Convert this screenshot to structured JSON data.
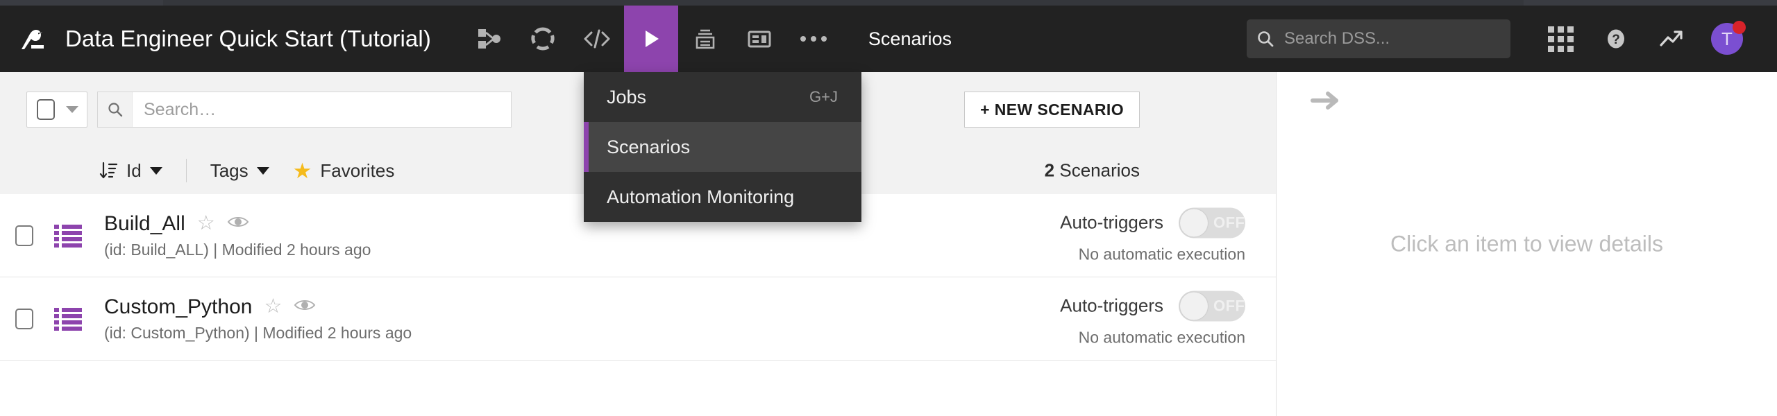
{
  "header": {
    "logo_icon": "dataiku-bird-logo",
    "project_title": "Data Engineer Quick Start (Tutorial)",
    "breadcrumb": "Scenarios",
    "nav_icons": [
      {
        "name": "flow-icon",
        "label": "Flow"
      },
      {
        "name": "lab-icon",
        "label": "Lab"
      },
      {
        "name": "code-icon",
        "label": "Code"
      },
      {
        "name": "automation-play-icon",
        "label": "Automation",
        "active": true
      },
      {
        "name": "print-stack-icon",
        "label": "Deployer"
      },
      {
        "name": "dashboard-icon",
        "label": "Dashboards"
      },
      {
        "name": "more-dots-icon",
        "label": "More"
      }
    ],
    "search": {
      "placeholder": "Search DSS...",
      "icon": "search-icon"
    },
    "right_icons": [
      {
        "name": "apps-grid-icon"
      },
      {
        "name": "help-question-icon"
      },
      {
        "name": "trends-arrow-icon"
      }
    ],
    "avatar": {
      "initials": "T",
      "has_notification": true,
      "color": "#7b4fd1"
    }
  },
  "dropdown": {
    "items": [
      {
        "label": "Jobs",
        "shortcut": "G+J",
        "highlighted": false
      },
      {
        "label": "Scenarios",
        "shortcut": "",
        "highlighted": true
      },
      {
        "label": "Automation Monitoring",
        "shortcut": "",
        "highlighted": false
      }
    ]
  },
  "toolbar": {
    "select_all_checkbox": "",
    "search_placeholder": "Search…",
    "new_scenario_label": "+ NEW SCENARIO"
  },
  "filterbar": {
    "sort_icon": "sort-descending-icon",
    "sort_label": "Id",
    "tags_label": "Tags",
    "favorites_label": "Favorites",
    "favorites_icon": "star-filled-icon",
    "count_number": "2",
    "count_label": "Scenarios"
  },
  "rows": [
    {
      "name": "Build_All",
      "meta": "(id: Build_ALL) | Modified 2 hours ago",
      "icon": "scenario-list-icon",
      "star": "star-outline-icon",
      "watch": "eye-icon",
      "trigger_label": "Auto-triggers",
      "toggle_state": "OFF",
      "execution_note": "No automatic execution"
    },
    {
      "name": "Custom_Python",
      "meta": "(id: Custom_Python) | Modified 2 hours ago",
      "icon": "scenario-list-icon",
      "star": "star-outline-icon",
      "watch": "eye-icon",
      "trigger_label": "Auto-triggers",
      "toggle_state": "OFF",
      "execution_note": "No automatic execution"
    }
  ],
  "right_panel": {
    "collapse_icon": "arrow-right-icon",
    "empty_message": "Click an item to view details"
  },
  "colors": {
    "accent_purple": "#8d44ad",
    "header_bg": "#222222",
    "menu_bg": "#303030",
    "menu_highlight": "#454545",
    "star_gold": "#f5bb1d",
    "notification_red": "#d8232a",
    "avatar_purple": "#7b4fd1"
  }
}
